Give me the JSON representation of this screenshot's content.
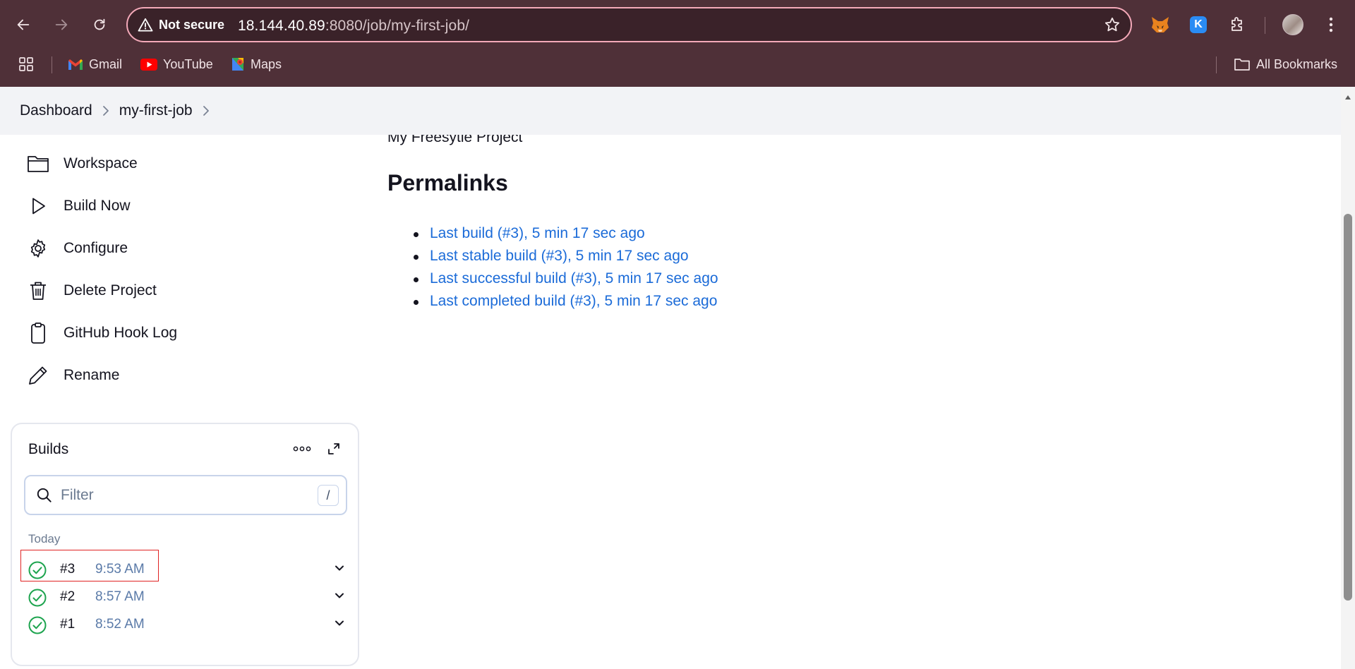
{
  "browser": {
    "security_label": "Not secure",
    "url_host": "18.144.40.89",
    "url_rest": ":8080/job/my-first-job/",
    "bookmarks": [
      {
        "label": "Gmail",
        "icon": "gmail-icon"
      },
      {
        "label": "YouTube",
        "icon": "youtube-icon"
      },
      {
        "label": "Maps",
        "icon": "maps-icon"
      }
    ],
    "all_bookmarks_label": "All Bookmarks",
    "extension_k_letter": "K"
  },
  "breadcrumb": {
    "items": [
      "Dashboard",
      "my-first-job"
    ]
  },
  "sidebar": {
    "tasks": [
      {
        "label": "Workspace",
        "icon": "folder-icon"
      },
      {
        "label": "Build Now",
        "icon": "play-icon"
      },
      {
        "label": "Configure",
        "icon": "gear-icon"
      },
      {
        "label": "Delete Project",
        "icon": "trash-icon"
      },
      {
        "label": "GitHub Hook Log",
        "icon": "clipboard-icon"
      },
      {
        "label": "Rename",
        "icon": "pencil-icon"
      }
    ]
  },
  "main": {
    "description": "My Freesytle Project",
    "permalinks_title": "Permalinks",
    "permalinks": [
      "Last build (#3), 5 min 17 sec ago",
      "Last stable build (#3), 5 min 17 sec ago",
      "Last successful build (#3), 5 min 17 sec ago",
      "Last completed build (#3), 5 min 17 sec ago"
    ]
  },
  "builds": {
    "title": "Builds",
    "filter_placeholder": "Filter",
    "filter_shortcut": "/",
    "group_label": "Today",
    "items": [
      {
        "number": "#3",
        "time": "9:53 AM",
        "status": "success"
      },
      {
        "number": "#2",
        "time": "8:57 AM",
        "status": "success"
      },
      {
        "number": "#1",
        "time": "8:52 AM",
        "status": "success"
      }
    ]
  },
  "colors": {
    "chrome_bg": "#4f3038",
    "omnibox_border": "#f4a9b9",
    "link": "#1b6bd8",
    "success": "#1ea44f",
    "highlight": "#e02424"
  }
}
